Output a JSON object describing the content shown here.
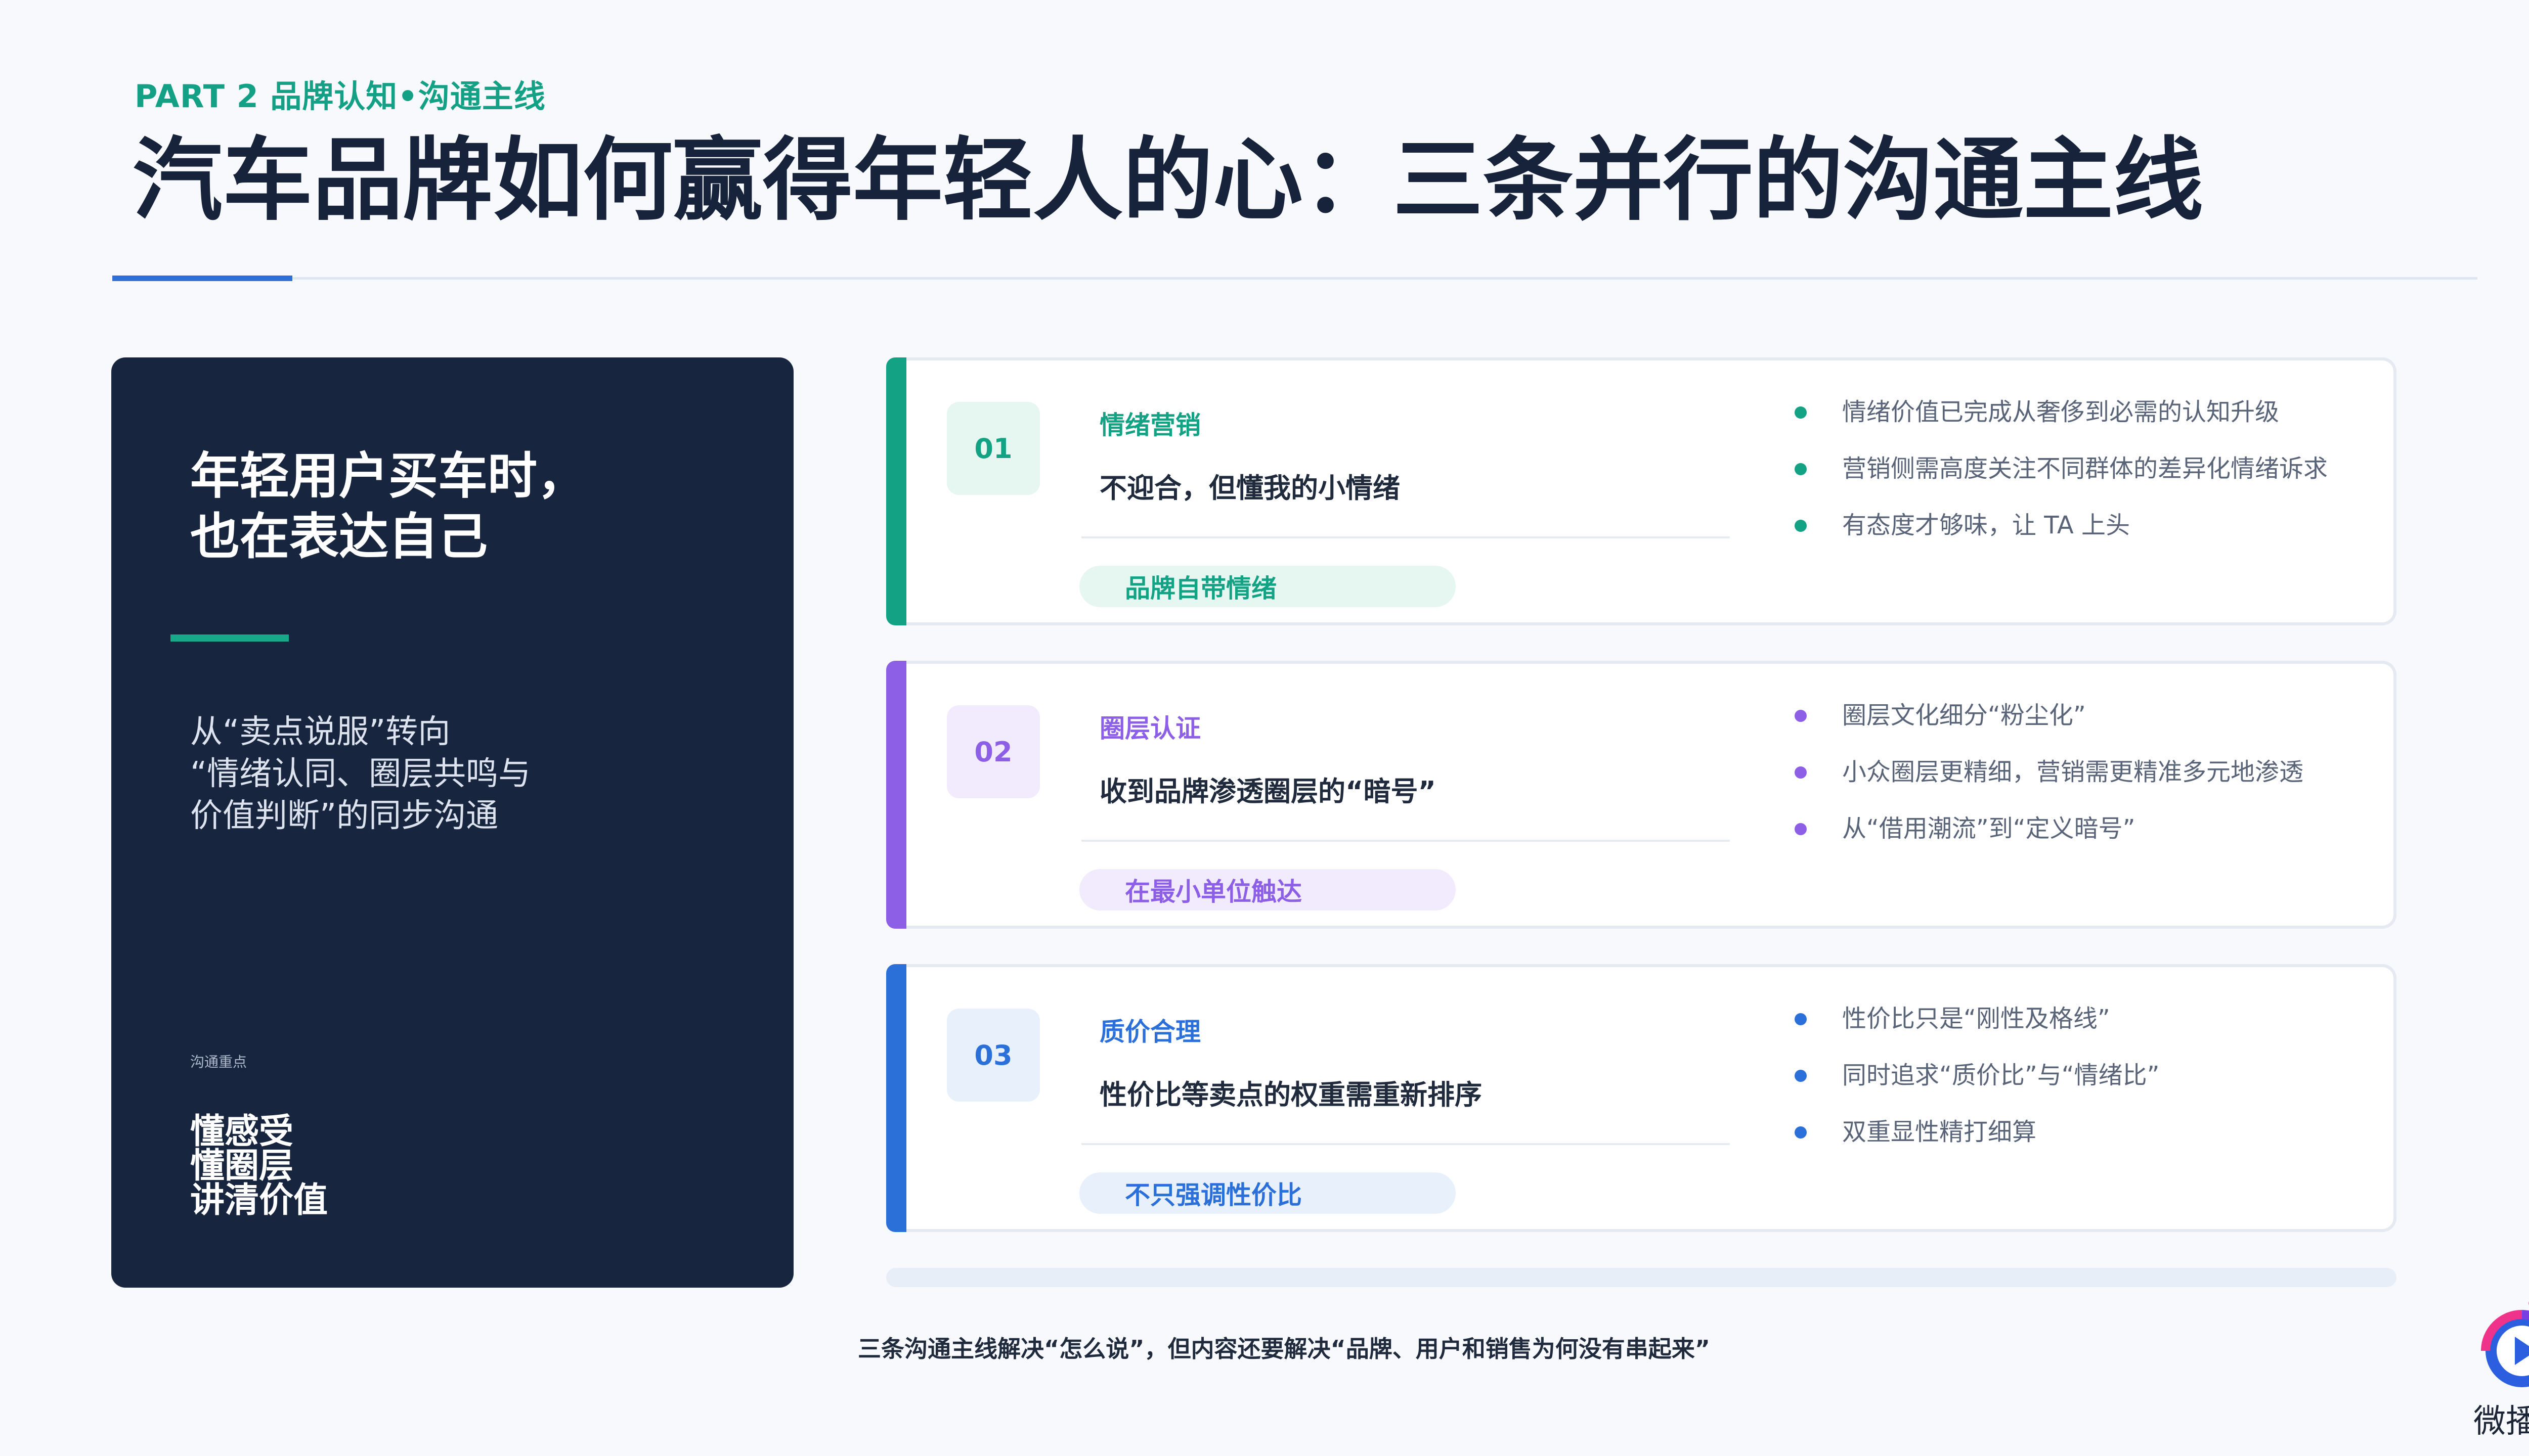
{
  "header": {
    "kicker": "PART 2 品牌认知•沟通主线",
    "title": "汽车品牌如何赢得年轻人的心：三条并行的沟通主线"
  },
  "hero": {
    "heading_lines": [
      "年轻用户买车时，",
      "也在表达自己"
    ],
    "body_lines": [
      "从“卖点说服”转向",
      "“情绪认同、圈层共鸣与",
      "价值判断”的同步沟通"
    ],
    "small_label": "沟通重点",
    "points": [
      "懂感受",
      "懂圈层",
      "讲清价值"
    ]
  },
  "cards": [
    {
      "number": "01",
      "tag": "情绪营销",
      "subtitle": "不迎合，但懂我的小情绪",
      "pill": "品牌自带情绪",
      "color": "#13a283",
      "bullets": [
        "情绪价值已完成从奢侈到必需的认知升级",
        "营销侧需高度关注不同群体的差异化情绪诉求",
        "有态度才够味，让 TA 上头"
      ]
    },
    {
      "number": "02",
      "tag": "圈层认证",
      "subtitle": "收到品牌渗透圈层的“暗号”",
      "pill": "在最小单位触达",
      "color": "#8c5fe6",
      "bullets": [
        "圈层文化细分“粉尘化”",
        "小众圈层更精细，营销需更精准多元地渗透",
        "从“借用潮流”到“定义暗号”"
      ]
    },
    {
      "number": "03",
      "tag": "质价合理",
      "subtitle": "性价比等卖点的权重需重新排序",
      "pill": "不只强调性价比",
      "color": "#2b6fd8",
      "bullets": [
        "性价比只是“刚性及格线”",
        "同时追求“质价比”与“情绪比”",
        "双重显性精打细算"
      ]
    }
  ],
  "footer": "三条沟通主线解决“怎么说”，但内容还要解决“品牌、用户和销售为何没有串起来”",
  "logo": {
    "text": "微播易",
    "icon": "play-icon"
  }
}
